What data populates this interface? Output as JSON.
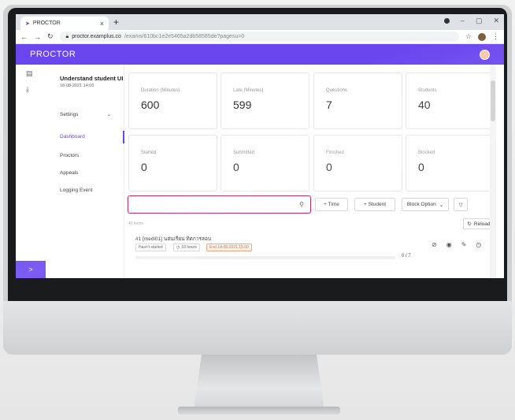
{
  "browser": {
    "tab_title": "PROCTOR",
    "tab_close": "×",
    "new_tab": "+",
    "url_host": "proctor.examplus.co",
    "url_path": "/exams/610bc1e2e5465a2db58585de?pagesu=0"
  },
  "app": {
    "brand": "PROCTOR",
    "accent_color": "#6a46ef"
  },
  "sidebar": {
    "exam_title": "Understand student UI",
    "exam_date": "18-08-2021 14:00",
    "items": [
      {
        "label": "Settings"
      },
      {
        "label": "Dashboard"
      },
      {
        "label": "Proctors"
      },
      {
        "label": "Appeals"
      },
      {
        "label": "Logging Event"
      }
    ],
    "active_item": "Dashboard",
    "expand_icon": ">"
  },
  "stats": [
    {
      "label": "Duration (Minutes)",
      "value": "600"
    },
    {
      "label": "Late (Minutes)",
      "value": "599"
    },
    {
      "label": "Questions",
      "value": "7"
    },
    {
      "label": "Students",
      "value": "40"
    },
    {
      "label": "Started",
      "value": "0"
    },
    {
      "label": "Submitted",
      "value": "0"
    },
    {
      "label": "Finished",
      "value": "0"
    },
    {
      "label": "Blocked",
      "value": "0"
    }
  ],
  "toolbar": {
    "search_placeholder": "",
    "time_button": "+ Time",
    "student_button": "+ Student",
    "block_option": "Block Option",
    "block_option_chevron": "⌄",
    "reload_button": "Reload"
  },
  "list": {
    "items_count": "40 items",
    "rows": [
      {
        "title": "#1 [medi01] นฮ่นเรียน ทิดการสอบ",
        "status_tag": "Hasn't started",
        "time_tag": "10 hours",
        "end_tag": "End 18-08-2021 15:00",
        "progress_label": "0 / 7",
        "progress_fraction": 0
      }
    ]
  },
  "icons": {
    "search": "search-icon",
    "filter": "filter-icon",
    "reload": "reload-icon",
    "clock": "clock-icon"
  }
}
